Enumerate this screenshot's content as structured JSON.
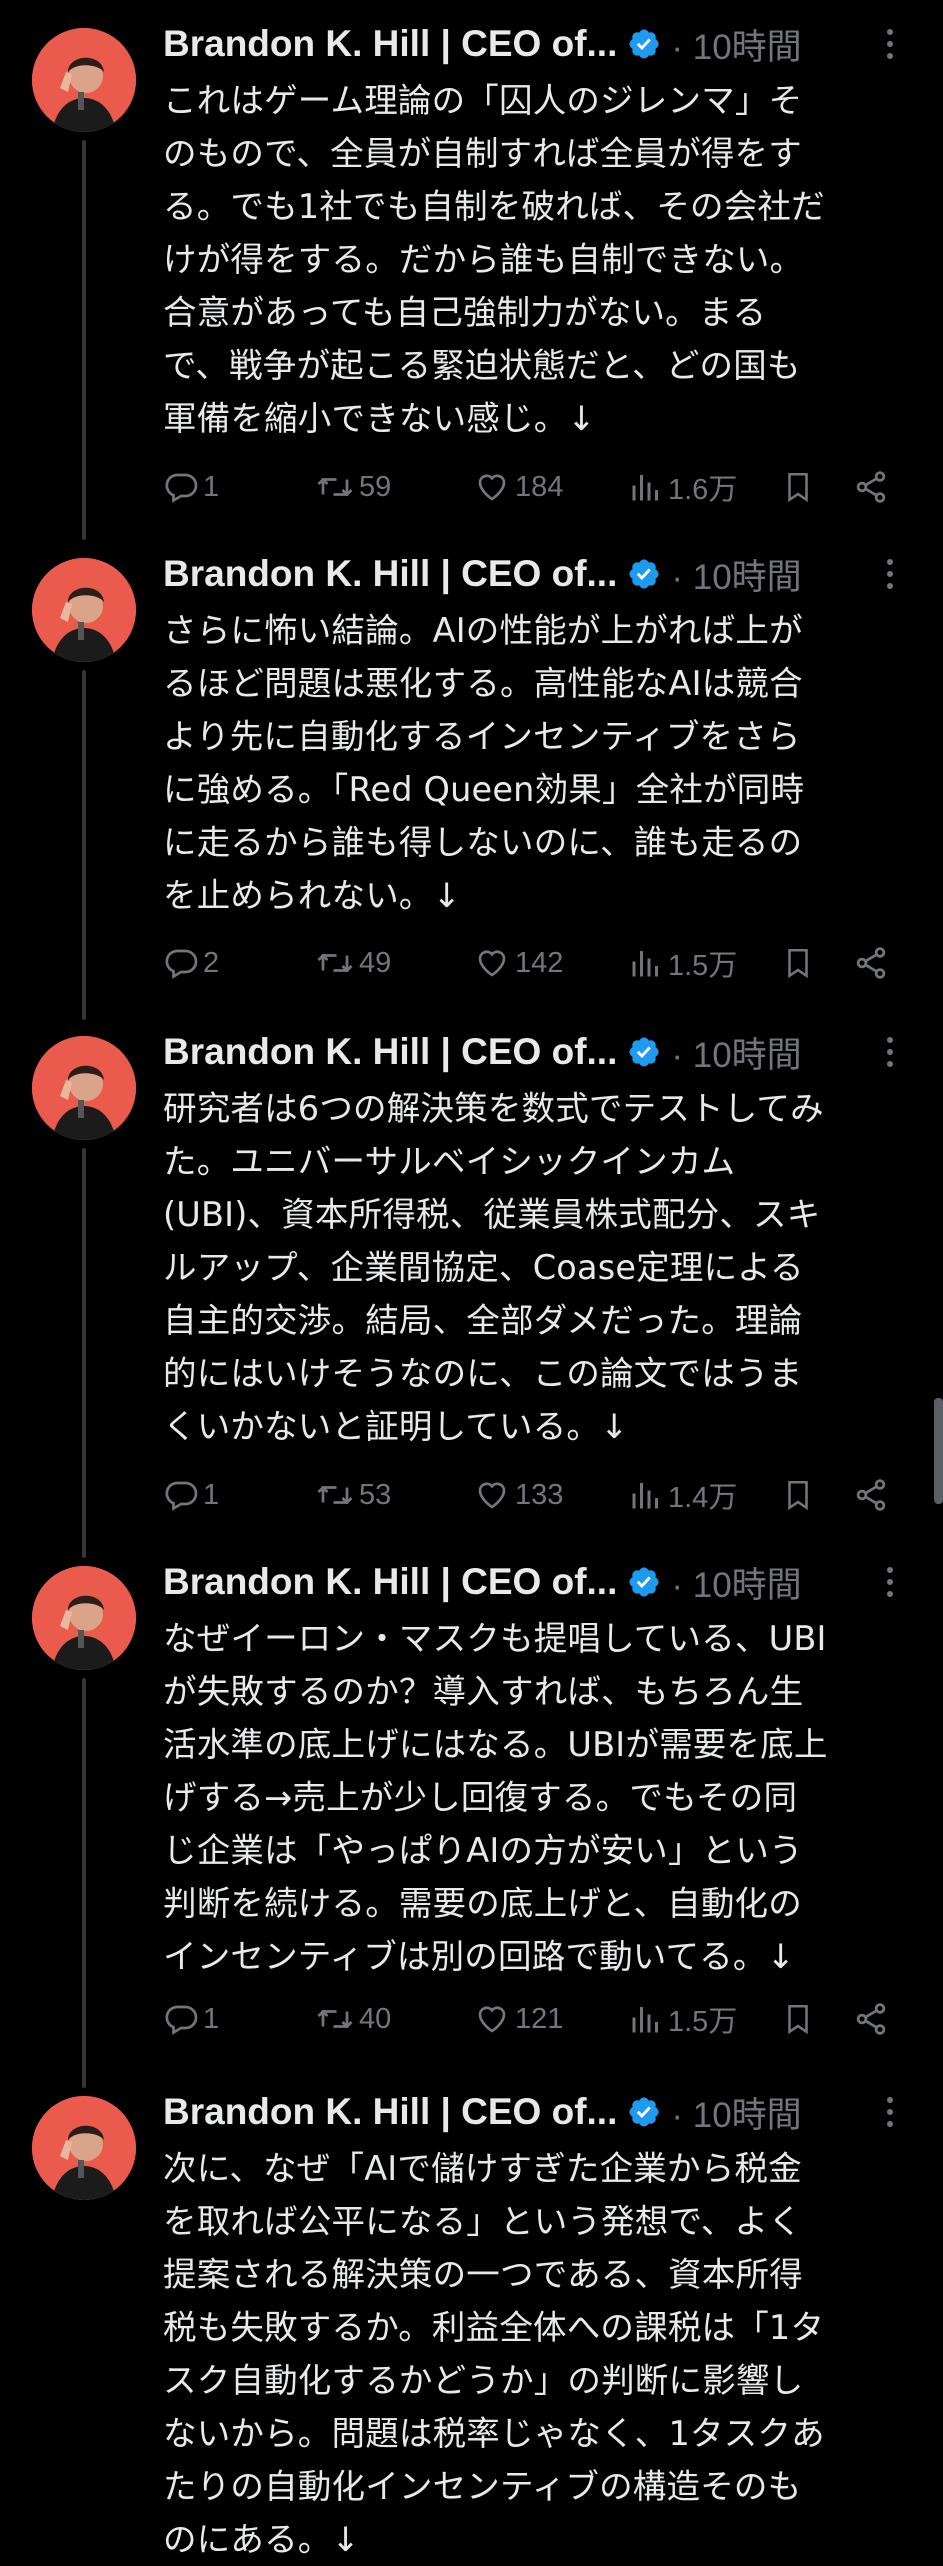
{
  "author": {
    "display_name": "Brandon K. Hill | CEO of...",
    "verified": true,
    "avatar_color": "#ea5b4e",
    "verified_color": "#1d9bf0"
  },
  "tweets": [
    {
      "time": "· 10時間",
      "text": "これはゲーム理論の「囚人のジレンマ」そ\nのもので、全員が自制すれば全員が得をす\nる。でも1社でも自制を破れば、その会社だ\nけが得をする。だから誰も自制できない。\n合意があっても自己強制力がない。まる\nで、戦争が起こる緊迫状態だと、どの国も\n軍備を縮小できない感じ。↓",
      "replies": "1",
      "retweets": "59",
      "likes": "184",
      "views": "1.6万"
    },
    {
      "time": "· 10時間",
      "text": "さらに怖い結論。AIの性能が上がれば上が\nるほど問題は悪化する。高性能なAIは競合\nより先に自動化するインセンティブをさら\nに強める。「Red Queen効果」全社が同時\nに走るから誰も得しないのに、誰も走るの\nを止められない。↓",
      "replies": "2",
      "retweets": "49",
      "likes": "142",
      "views": "1.5万"
    },
    {
      "time": "· 10時間",
      "text": "研究者は6つの解決策を数式でテストしてみ\nた。ユニバーサルベイシックインカム\n(UBI)、資本所得税、従業員株式配分、スキ\nルアップ、企業間協定、Coase定理による\n自主的交渉。結局、全部ダメだった。理論\n的にはいけそうなのに、この論文ではうま\nくいかないと証明している。↓",
      "replies": "1",
      "retweets": "53",
      "likes": "133",
      "views": "1.4万"
    },
    {
      "time": "· 10時間",
      "text": "なぜイーロン・マスクも提唱している、UBI\nが失敗するのか？導入すれば、もちろん生\n活水準の底上げにはなる。UBIが需要を底上\nげする→売上が少し回復する。でもその同\nじ企業は「やっぱりAIの方が安い」という\n判断を続ける。需要の底上げと、自動化の\nインセンティブは別の回路で動いてる。↓",
      "replies": "1",
      "retweets": "40",
      "likes": "121",
      "views": "1.5万"
    },
    {
      "time": "· 10時間",
      "text": "次に、なぜ「AIで儲けすぎた企業から税金\nを取れば公平になる」という発想で、よく\n提案される解決策の一つである、資本所得\n税も失敗するか。利益全体への課税は「1タ\nスク自動化するかどうか」の判断に影響し\nないから。問題は税率じゃなく、1タスクあ\nたりの自動化インセンティブの構造そのも\nのにある。↓"
    }
  ]
}
